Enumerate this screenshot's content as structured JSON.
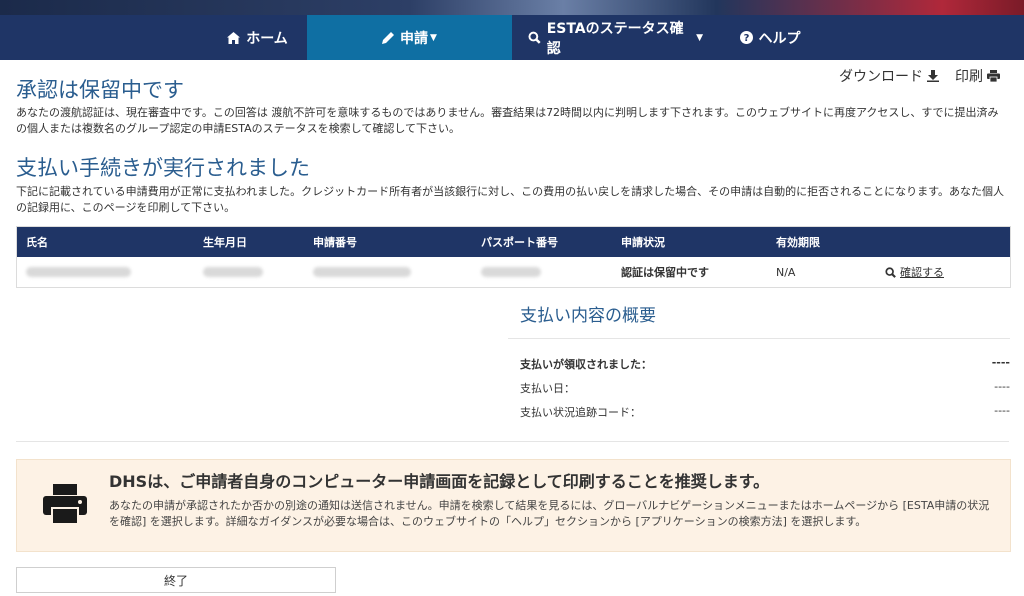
{
  "nav": {
    "home": "ホーム",
    "apply": "申請",
    "status": "ESTAのステータス確認",
    "help": "ヘルプ"
  },
  "actions": {
    "download": "ダウンロード",
    "print": "印刷"
  },
  "pending": {
    "title": "承認は保留中です",
    "text": "あなたの渡航認証は、現在審査中です。この回答は 渡航不許可を意味するものではありません。審査結果は72時間以内に判明します下されます。このウェブサイトに再度アクセスし、すでに提出済みの個人または複数名のグループ認定の申請ESTAのステータスを検索して確認して下さい。"
  },
  "payment": {
    "title": "支払い手続きが実行されました",
    "text": "下記に記載されている申請費用が正常に支払われました。クレジットカード所有者が当該銀行に対し、この費用の払い戻しを請求した場合、その申請は自動的に拒否されることになります。あなた個人の記録用に、このページを印刷して下さい。"
  },
  "table": {
    "headers": [
      "氏名",
      "生年月日",
      "申請番号",
      "パスポート番号",
      "申請状況",
      "有効期限"
    ],
    "row": {
      "status": "認証は保留中です",
      "expiry": "N/A",
      "confirm": "確認する"
    }
  },
  "summary": {
    "title": "支払い内容の概要",
    "received_label": "支払いが領収されました：",
    "received_value": "----",
    "date_label": "支払い日：",
    "date_value": "----",
    "tracking_label": "支払い状況追跡コード：",
    "tracking_value": "----"
  },
  "notice": {
    "title": "DHSは、ご申請者自身のコンピューター申請画面を記録として印刷することを推奨します。",
    "text": "あなたの申請が承認されたか否かの別途の通知は送信されません。申請を検索して結果を見るには、グローバルナビゲーションメニューまたはホームページから [ESTA申請の状況を確認] を選択します。詳細なガイダンスが必要な場合は、このウェブサイトの「ヘルプ」セクションから [アプリケーションの検索方法] を選択します。"
  },
  "end_button": "終了"
}
